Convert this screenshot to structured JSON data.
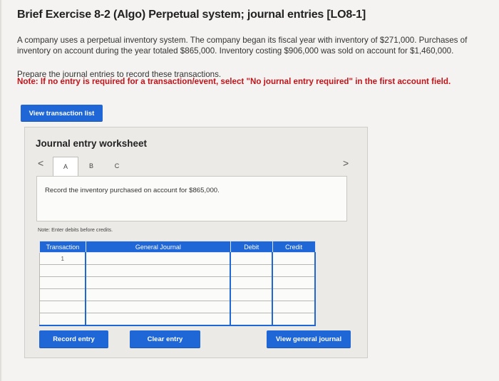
{
  "header": {
    "title": "Brief Exercise 8-2 (Algo) Perpetual system; journal entries [LO8-1]"
  },
  "problem": {
    "paragraph": "A company uses a perpetual inventory system. The company began its fiscal year with inventory of $271,000. Purchases of inventory on account during the year totaled $865,000. Inventory costing $906,000 was sold on account for $1,460,000.",
    "instruction": "Prepare the journal entries to record these transactions.",
    "note": "Note: If no entry is required for a transaction/event, select \"No journal entry required\" in the first account field."
  },
  "buttons": {
    "view_transaction_list": "View transaction list",
    "record_entry": "Record entry",
    "clear_entry": "Clear entry",
    "view_general_journal": "View general journal"
  },
  "worksheet": {
    "title": "Journal entry worksheet",
    "tabs": [
      "A",
      "B",
      "C"
    ],
    "active_tab": "A",
    "prompt": "Record the inventory purchased on account for $865,000.",
    "note": "Note: Enter debits before credits.",
    "columns": [
      "Transaction",
      "General Journal",
      "Debit",
      "Credit"
    ],
    "rows": [
      {
        "transaction": "1",
        "account": "",
        "debit": "",
        "credit": ""
      },
      {
        "transaction": "",
        "account": "",
        "debit": "",
        "credit": ""
      },
      {
        "transaction": "",
        "account": "",
        "debit": "",
        "credit": ""
      },
      {
        "transaction": "",
        "account": "",
        "debit": "",
        "credit": ""
      },
      {
        "transaction": "",
        "account": "",
        "debit": "",
        "credit": ""
      },
      {
        "transaction": "",
        "account": "",
        "debit": "",
        "credit": ""
      }
    ]
  },
  "colors": {
    "accent": "#1f67d6",
    "note_red": "#c0141b"
  }
}
